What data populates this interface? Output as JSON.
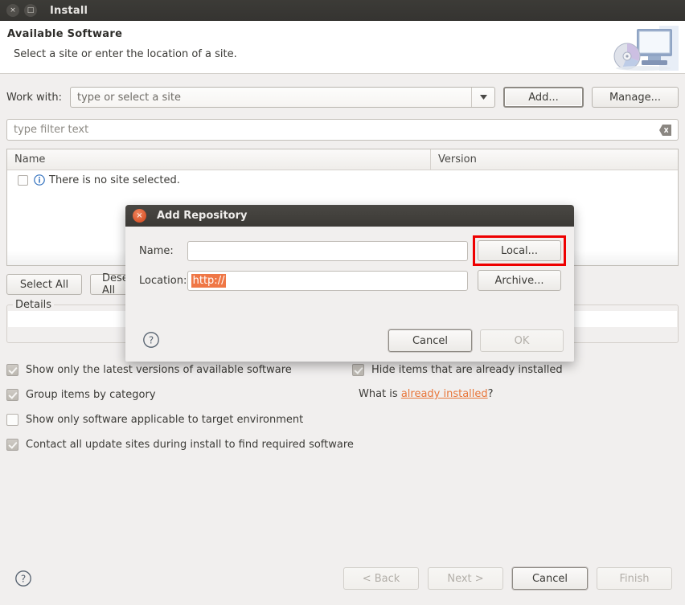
{
  "window": {
    "title": "Install",
    "close_icon": "×",
    "maximize_icon": "□"
  },
  "banner": {
    "title": "Available Software",
    "subtitle": "Select a site or enter the location of a site.",
    "icon": "monitor-cd-icon"
  },
  "work_with": {
    "label": "Work with:",
    "combo_value": "type or select a site",
    "dropdown_icon": "chevron-down-icon",
    "add_label": "Add...",
    "manage_label": "Manage..."
  },
  "filter": {
    "placeholder": "type filter text",
    "value": "",
    "clear_icon": "clear-text-icon"
  },
  "table": {
    "columns": [
      "Name",
      "Version"
    ],
    "rows": [
      {
        "name": "There is no site selected.",
        "version": "",
        "icon": "info-icon",
        "checked": false
      }
    ]
  },
  "selection_buttons": {
    "select_all": "Select All",
    "deselect_all": "Deselect All"
  },
  "details": {
    "title": "Details",
    "text": ""
  },
  "options": {
    "left": [
      {
        "label": "Show only the latest versions of available software",
        "checked": true
      },
      {
        "label": "Group items by category",
        "checked": true
      },
      {
        "label": "Show only software applicable to target environment",
        "checked": false
      },
      {
        "label": "Contact all update sites during install to find required software",
        "checked": true
      }
    ],
    "right": [
      {
        "label": "Hide items that are already installed",
        "checked": true
      }
    ],
    "what_is_prefix": "What is ",
    "what_is_link": "already installed",
    "what_is_suffix": "?"
  },
  "footer": {
    "help_icon": "help-icon",
    "back": "< Back",
    "next": "Next >",
    "cancel": "Cancel",
    "finish": "Finish"
  },
  "dialog": {
    "title": "Add Repository",
    "close_icon": "×",
    "name_label": "Name:",
    "name_value": "",
    "location_label": "Location:",
    "location_value": "http://",
    "local_label": "Local...",
    "archive_label": "Archive...",
    "help_icon": "help-icon",
    "cancel": "Cancel",
    "ok": "OK",
    "highlight_color": "#ee0000",
    "selection_color": "#ef7746"
  }
}
